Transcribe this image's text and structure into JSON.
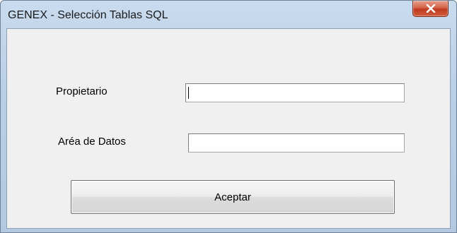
{
  "window": {
    "title": "GENEX - Selección Tablas SQL",
    "close_icon": "close-icon"
  },
  "form": {
    "owner_label": "Propietario",
    "owner_value": "",
    "data_area_label": "Aréa de Datos",
    "data_area_value": "",
    "accept_label": "Aceptar"
  },
  "colors": {
    "titlebar": "#b9cfe6",
    "client_background": "#f0f0f0",
    "close_button": "#c7472b"
  }
}
